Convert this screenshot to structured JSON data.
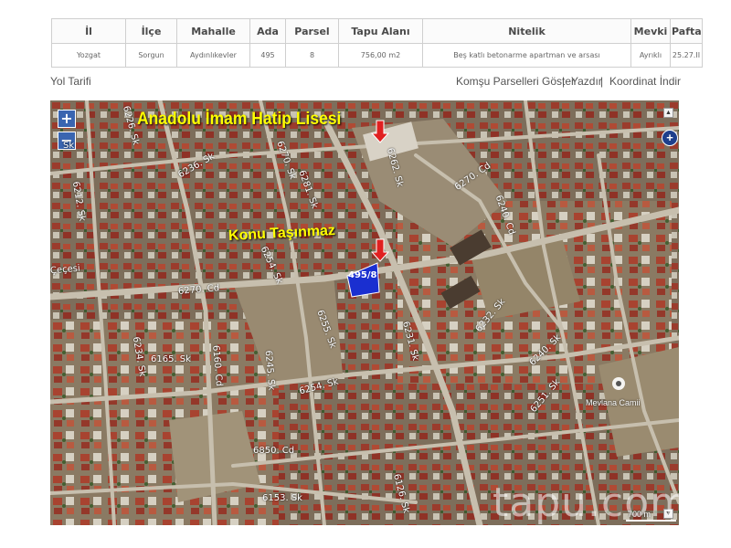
{
  "parcel_table": {
    "headers": [
      "İl",
      "İlçe",
      "Mahalle",
      "Ada",
      "Parsel",
      "Tapu Alanı",
      "Nitelik",
      "Mevki",
      "Pafta"
    ],
    "row": [
      "Yozgat",
      "Sorgun",
      "Aydınlıkevler",
      "495",
      "8",
      "756,00 m2",
      "Beş katlı betonarme apartman ve arsası",
      "Ayrıklı",
      "25.27.II"
    ]
  },
  "links": {
    "directions": "Yol Tarifi",
    "neighbor_parcels": "Komşu Parselleri Göster",
    "print": "Yazdır",
    "download_coords": "Koordinat İndir",
    "separator": "|"
  },
  "map": {
    "zoom_in": "+",
    "zoom_out": "−",
    "expand": "+",
    "school_label": "Anadolu İmam Hatip Lisesi",
    "property_label": "Konu Taşınmaz",
    "parcel_number": "495/8",
    "mosque_label": "Mevlana Camii",
    "watermark": "tapu.com",
    "scale": "700 m",
    "streets": [
      "6226. Sk",
      "Sk",
      "6270. Sk",
      "6236. Sk",
      "6270. Cd",
      "6262. Sk",
      "6281. Sk",
      "6270. Cd",
      "6254. Sk",
      "6212. Sk",
      "6255. Sk",
      "6165. Sk",
      "6160. Cd",
      "6245. Sk",
      "6234. Sk",
      "6231. Sk",
      "6254. Sk",
      "6232. Sk",
      "6240. Sk",
      "6251. Sk",
      "6850. Cd",
      "6153. Sk",
      "6126. Sk",
      "6240. Cd",
      "Çeçesi"
    ]
  },
  "colors": {
    "zoom": "#3a65b0",
    "label_yellow": "#ffff00",
    "arrow_red": "#e02020",
    "parcel_fill": "#1a2fd0"
  }
}
